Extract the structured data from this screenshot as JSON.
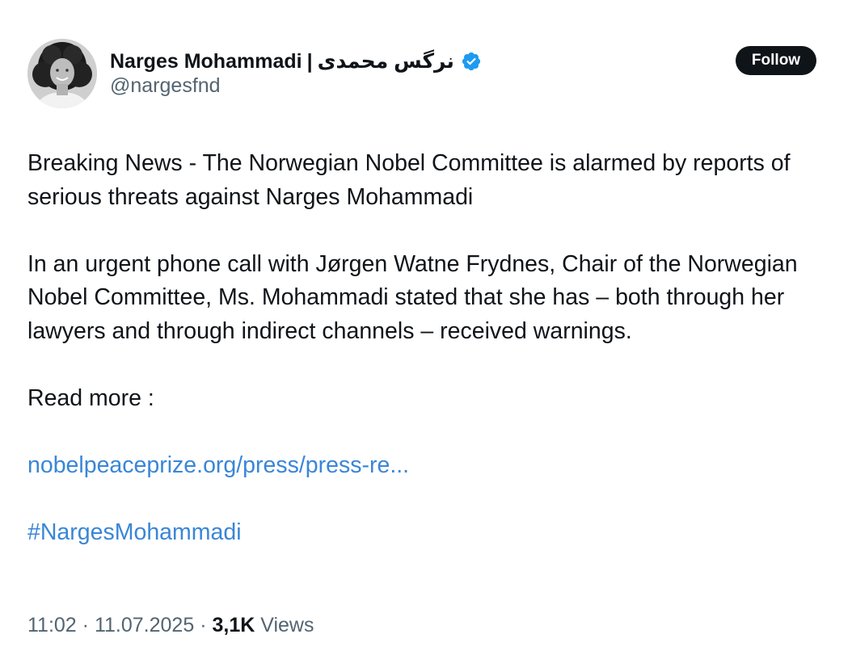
{
  "author": {
    "display_name": "Narges Mohammadi",
    "separator": "|",
    "display_name_fa": "نرگس محمدی",
    "handle": "@nargesfnd",
    "verified_icon": "verified-badge-icon",
    "avatar_icon": "avatar-photo"
  },
  "actions": {
    "follow_label": "Follow"
  },
  "tweet": {
    "line1": "Breaking News - The Norwegian Nobel Committee is alarmed by reports of serious threats against Narges Mohammadi",
    "paragraph2": "In an urgent phone call with Jørgen Watne Frydnes, Chair of the Norwegian Nobel Committee, Ms. Mohammadi stated that she has – both through her lawyers and through indirect channels – received warnings.",
    "read_more": "Read more :",
    "link": "nobelpeaceprize.org/press/press-re...",
    "hashtag": "#NargesMohammadi"
  },
  "meta": {
    "time": "11:02",
    "dot1": "·",
    "date": "11.07.2025",
    "dot2": "·",
    "views_count": "3,1K",
    "views_label": "Views"
  },
  "colors": {
    "link": "#3a86d6",
    "secondary_text": "#536471",
    "primary_text": "#0f1419",
    "verified": "#1d9bf0"
  }
}
